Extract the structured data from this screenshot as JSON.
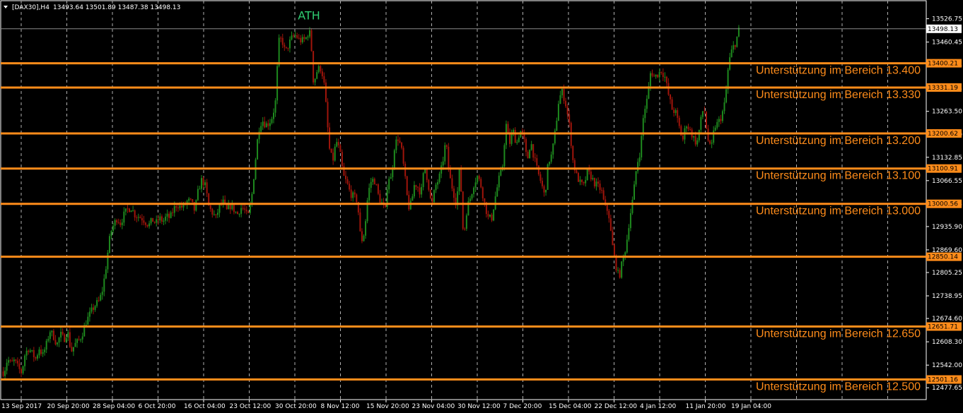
{
  "chart_data": {
    "type": "candlestick",
    "symbol_header": {
      "symbol": "[DAX30],H4",
      "ohlc": "13493.64 13501.89 13487.38 13498.13"
    },
    "y_range": [
      12444.0,
      13578.0
    ],
    "y_ticks": [
      "13526.75",
      "13460.45",
      "13394.15",
      "13328.45",
      "13263.50",
      "13197.20",
      "13132.85",
      "13066.55",
      "13000.25",
      "12935.90",
      "12869.60",
      "12805.25",
      "12738.95",
      "12674.60",
      "12608.30",
      "12542.00",
      "12477.65"
    ],
    "x_labels": [
      "13 Sep 2017",
      "20 Sep 20:00",
      "28 Sep 04:00",
      "6 Oct 20:00",
      "16 Oct 04:00",
      "23 Oct 12:00",
      "30 Oct 20:00",
      "8 Nov 12:00",
      "15 Nov 20:00",
      "23 Nov 04:00",
      "30 Nov 12:00",
      "7 Dec 20:00",
      "15 Dec 04:00",
      "22 Dec 12:00",
      "4 Jan 12:00",
      "11 Jan 20:00",
      "19 Jan 04:00"
    ],
    "current_price": "13498.13",
    "support_levels": [
      {
        "price": 13400.21,
        "price_label": "13400.21",
        "text": "Unterstützung  im Bereich 13.400"
      },
      {
        "price": 13331.19,
        "price_label": "13331.19",
        "text": "Unterstützung im Bereich 13.330"
      },
      {
        "price": 13200.62,
        "price_label": "13200.62",
        "text": "Unterstützung im Bereich 13.200"
      },
      {
        "price": 13100.91,
        "price_label": "13100.91",
        "text": "Unterstützung im Bereich 13.100"
      },
      {
        "price": 13000.56,
        "price_label": "13000.56",
        "text": "Unterstützung im Bereich 13.000"
      },
      {
        "price": 12850.14,
        "price_label": "12850.14",
        "text": ""
      },
      {
        "price": 12651.71,
        "price_label": "12651.71",
        "text": "Unterstützung im Bereich 12.650"
      },
      {
        "price": 12501.16,
        "price_label": "12501.16",
        "text": "Unterstützung im Bereich 12.500"
      }
    ],
    "annotations": [
      {
        "text": "ATH",
        "price": 13513
      }
    ],
    "price_path": [
      [
        0,
        12530
      ],
      [
        5,
        12520
      ],
      [
        10,
        12560
      ],
      [
        15,
        12545
      ],
      [
        20,
        12555
      ],
      [
        25,
        12535
      ],
      [
        30,
        12520
      ],
      [
        35,
        12575
      ],
      [
        40,
        12590
      ],
      [
        45,
        12575
      ],
      [
        50,
        12560
      ],
      [
        55,
        12590
      ],
      [
        60,
        12570
      ],
      [
        65,
        12600
      ],
      [
        70,
        12640
      ],
      [
        75,
        12625
      ],
      [
        80,
        12600
      ],
      [
        85,
        12630
      ],
      [
        90,
        12615
      ],
      [
        95,
        12640
      ],
      [
        100,
        12580
      ],
      [
        105,
        12600
      ],
      [
        110,
        12610
      ],
      [
        115,
        12625
      ],
      [
        120,
        12660
      ],
      [
        125,
        12680
      ],
      [
        130,
        12700
      ],
      [
        135,
        12715
      ],
      [
        140,
        12725
      ],
      [
        145,
        12760
      ],
      [
        150,
        12830
      ],
      [
        153,
        12880
      ],
      [
        156,
        12920
      ],
      [
        160,
        12940
      ],
      [
        165,
        12960
      ],
      [
        170,
        12945
      ],
      [
        175,
        12970
      ],
      [
        180,
        12985
      ],
      [
        185,
        12990
      ],
      [
        190,
        12970
      ],
      [
        195,
        12965
      ],
      [
        200,
        12960
      ],
      [
        205,
        12950
      ],
      [
        210,
        12940
      ],
      [
        215,
        12955
      ],
      [
        220,
        12945
      ],
      [
        225,
        12960
      ],
      [
        230,
        12950
      ],
      [
        235,
        12965
      ],
      [
        240,
        12960
      ],
      [
        245,
        12985
      ],
      [
        250,
        13000
      ],
      [
        255,
        12990
      ],
      [
        260,
        12995
      ],
      [
        265,
        13010
      ],
      [
        270,
        13005
      ],
      [
        275,
        12980
      ],
      [
        280,
        13040
      ],
      [
        285,
        13070
      ],
      [
        290,
        13050
      ],
      [
        295,
        12990
      ],
      [
        300,
        12975
      ],
      [
        305,
        12960
      ],
      [
        310,
        12995
      ],
      [
        315,
        13005
      ],
      [
        320,
        12980
      ],
      [
        325,
        12995
      ],
      [
        330,
        12985
      ],
      [
        335,
        12970
      ],
      [
        340,
        12990
      ],
      [
        345,
        12985
      ],
      [
        350,
        12960
      ],
      [
        355,
        13010
      ],
      [
        360,
        13110
      ],
      [
        365,
        13210
      ],
      [
        370,
        13240
      ],
      [
        375,
        13225
      ],
      [
        380,
        13230
      ],
      [
        385,
        13250
      ],
      [
        390,
        13300
      ],
      [
        393,
        13460
      ],
      [
        398,
        13470
      ],
      [
        403,
        13430
      ],
      [
        408,
        13455
      ],
      [
        413,
        13475
      ],
      [
        418,
        13480
      ],
      [
        423,
        13465
      ],
      [
        428,
        13465
      ],
      [
        432,
        13470
      ],
      [
        437,
        13495
      ],
      [
        440,
        13440
      ],
      [
        443,
        13340
      ],
      [
        447,
        13375
      ],
      [
        452,
        13390
      ],
      [
        457,
        13360
      ],
      [
        461,
        13270
      ],
      [
        465,
        13160
      ],
      [
        470,
        13120
      ],
      [
        475,
        13180
      ],
      [
        480,
        13150
      ],
      [
        485,
        13080
      ],
      [
        490,
        13060
      ],
      [
        495,
        13030
      ],
      [
        500,
        13020
      ],
      [
        505,
        13010
      ],
      [
        510,
        12890
      ],
      [
        515,
        12920
      ],
      [
        520,
        13030
      ],
      [
        525,
        13070
      ],
      [
        530,
        13065
      ],
      [
        535,
        13020
      ],
      [
        540,
        13000
      ],
      [
        545,
        12980
      ],
      [
        548,
        13080
      ],
      [
        553,
        13070
      ],
      [
        557,
        13160
      ],
      [
        562,
        13190
      ],
      [
        567,
        13160
      ],
      [
        572,
        13080
      ],
      [
        577,
        12990
      ],
      [
        581,
        13000
      ],
      [
        586,
        13060
      ],
      [
        590,
        13050
      ],
      [
        595,
        13030
      ],
      [
        600,
        13110
      ],
      [
        605,
        13060
      ],
      [
        610,
        12990
      ],
      [
        615,
        13050
      ],
      [
        620,
        13070
      ],
      [
        625,
        13110
      ],
      [
        630,
        13180
      ],
      [
        635,
        13080
      ],
      [
        640,
        13040
      ],
      [
        645,
        13000
      ],
      [
        650,
        13110
      ],
      [
        655,
        12900
      ],
      [
        660,
        12990
      ],
      [
        665,
        13020
      ],
      [
        670,
        13060
      ],
      [
        675,
        13080
      ],
      [
        680,
        13050
      ],
      [
        685,
        13000
      ],
      [
        690,
        12960
      ],
      [
        695,
        12960
      ],
      [
        700,
        13020
      ],
      [
        705,
        13070
      ],
      [
        710,
        13100
      ],
      [
        715,
        13230
      ],
      [
        720,
        13170
      ],
      [
        725,
        13210
      ],
      [
        730,
        13170
      ],
      [
        735,
        13210
      ],
      [
        740,
        13190
      ],
      [
        745,
        13120
      ],
      [
        750,
        13180
      ],
      [
        755,
        13130
      ],
      [
        760,
        13090
      ],
      [
        765,
        13060
      ],
      [
        770,
        13020
      ],
      [
        775,
        13120
      ],
      [
        780,
        13140
      ],
      [
        785,
        13210
      ],
      [
        790,
        13300
      ],
      [
        795,
        13320
      ],
      [
        800,
        13280
      ],
      [
        805,
        13220
      ],
      [
        810,
        13120
      ],
      [
        815,
        13080
      ],
      [
        820,
        13060
      ],
      [
        825,
        13050
      ],
      [
        830,
        13090
      ],
      [
        835,
        13080
      ],
      [
        840,
        13060
      ],
      [
        845,
        13050
      ],
      [
        850,
        13040
      ],
      [
        855,
        12990
      ],
      [
        860,
        12980
      ],
      [
        865,
        12890
      ],
      [
        870,
        12830
      ],
      [
        875,
        12790
      ],
      [
        880,
        12840
      ],
      [
        885,
        12880
      ],
      [
        890,
        12960
      ],
      [
        895,
        13020
      ],
      [
        900,
        13110
      ],
      [
        905,
        13150
      ],
      [
        910,
        13260
      ],
      [
        915,
        13300
      ],
      [
        920,
        13380
      ],
      [
        925,
        13360
      ],
      [
        930,
        13370
      ],
      [
        935,
        13380
      ],
      [
        940,
        13360
      ],
      [
        945,
        13310
      ],
      [
        950,
        13270
      ],
      [
        955,
        13260
      ],
      [
        960,
        13220
      ],
      [
        965,
        13180
      ],
      [
        970,
        13230
      ],
      [
        975,
        13210
      ],
      [
        980,
        13190
      ],
      [
        985,
        13170
      ],
      [
        990,
        13230
      ],
      [
        995,
        13280
      ],
      [
        1000,
        13190
      ],
      [
        1005,
        13150
      ],
      [
        1010,
        13220
      ],
      [
        1015,
        13230
      ],
      [
        1020,
        13250
      ],
      [
        1025,
        13290
      ],
      [
        1030,
        13400
      ],
      [
        1035,
        13440
      ],
      [
        1040,
        13460
      ],
      [
        1045,
        13498
      ]
    ]
  },
  "colors": {
    "background": "#000000",
    "grid": "#b0b0b0",
    "level": "#ff8c1a",
    "level_tag": "#ff8c1a",
    "bull": "#1e8a1e",
    "bear": "#a0150b",
    "ath": "#2ecc71",
    "axis_text": "#ffffff",
    "axis_line": "#ffffff"
  }
}
